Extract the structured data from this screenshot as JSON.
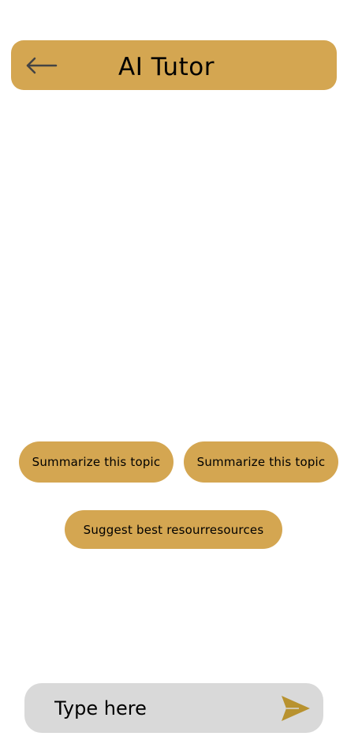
{
  "colors": {
    "accent": "#D4A651",
    "input_background": "#D9D9D9",
    "send_icon": "#B8922F",
    "back_icon": "#444444"
  },
  "header": {
    "title": "AI Tutor",
    "back_icon": "arrow-left-icon"
  },
  "suggestions": [
    {
      "label": "Summarize this topic"
    },
    {
      "label": "Summarize this topic"
    },
    {
      "label": "Suggest best resourresources"
    }
  ],
  "composer": {
    "placeholder": "Type here",
    "value": "",
    "send_icon": "send-icon"
  }
}
